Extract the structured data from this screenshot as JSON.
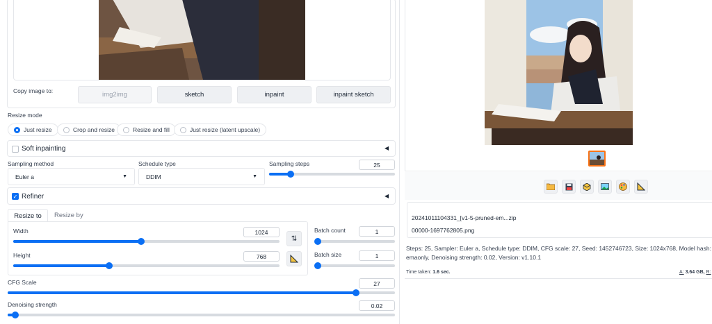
{
  "copy_image": {
    "label": "Copy image to:",
    "buttons": [
      "img2img",
      "sketch",
      "inpaint",
      "inpaint sketch"
    ]
  },
  "resize_mode": {
    "label": "Resize mode",
    "options": [
      "Just resize",
      "Crop and resize",
      "Resize and fill",
      "Just resize (latent upscale)"
    ],
    "selected": "Just resize"
  },
  "soft_inpainting": {
    "label": "Soft inpainting",
    "checked": false
  },
  "sampling": {
    "method_label": "Sampling method",
    "method_value": "Euler a",
    "schedule_label": "Schedule type",
    "schedule_value": "DDIM",
    "steps_label": "Sampling steps",
    "steps_value": "25",
    "steps_fraction": 0.17
  },
  "refiner": {
    "label": "Refiner",
    "checked": true
  },
  "size_tabs": [
    "Resize to",
    "Resize by"
  ],
  "width": {
    "label": "Width",
    "value": "1024",
    "fraction": 0.48
  },
  "height": {
    "label": "Height",
    "value": "768",
    "fraction": 0.36
  },
  "batch_count": {
    "label": "Batch count",
    "value": "1",
    "fraction": 0.0
  },
  "batch_size": {
    "label": "Batch size",
    "value": "1",
    "fraction": 0.0
  },
  "cfg_scale": {
    "label": "CFG Scale",
    "value": "27",
    "fraction": 0.9
  },
  "denoising": {
    "label": "Denoising strength",
    "value": "0.02",
    "fraction": 0.02
  },
  "output": {
    "files": [
      "20241011104331_[v1-5-pruned-em...zip",
      "00000-1697762805.png"
    ],
    "info_line1": "Steps: 25, Sampler: Euler a, Schedule type: DDIM, CFG scale: 27, Seed: 1452746723, Size: 1024x768, Model hash: 6ce0161689",
    "info_line2": "emaonly, Denoising strength: 0.02, Version: v1.10.1",
    "time_label": "Time taken:",
    "time_value": "1.6 sec.",
    "mem_a_label": "A:",
    "mem_a_value": "3.64 GB,",
    "mem_r_label": "R:",
    "mem_r_value": "5."
  },
  "icons": [
    "folder-icon",
    "save-icon",
    "zip-icon",
    "image-icon",
    "palette-icon",
    "ruler-icon",
    "swap-icon"
  ],
  "colors": {
    "accent": "#0b6ff4",
    "thumbnail_border": "#f97316"
  }
}
